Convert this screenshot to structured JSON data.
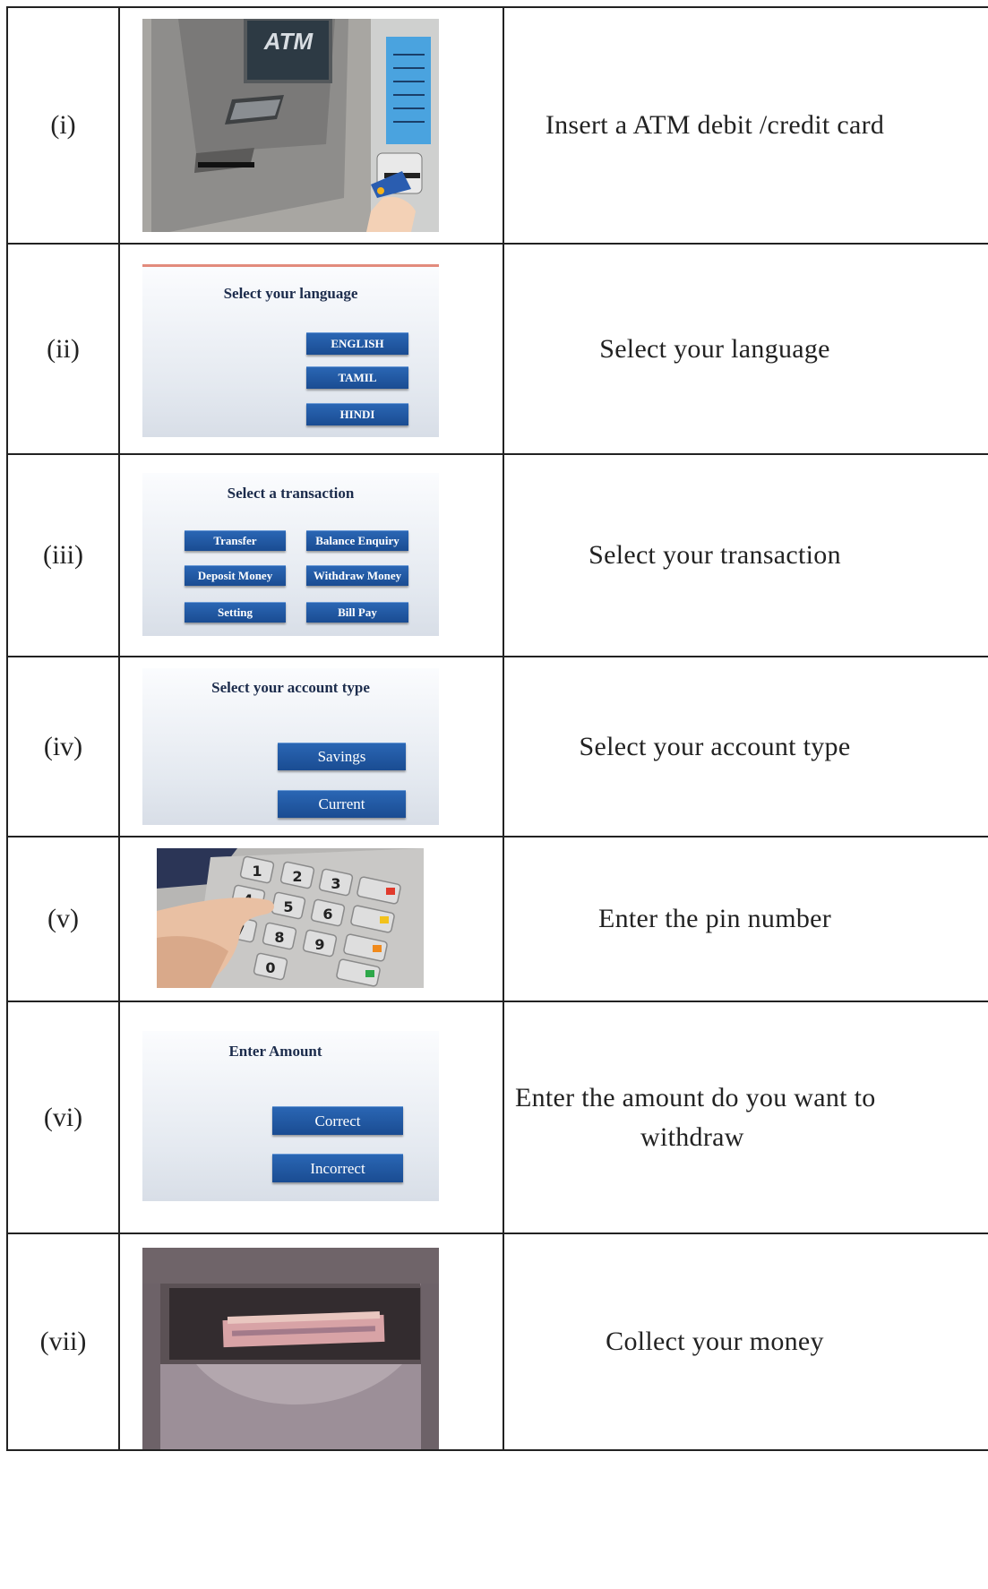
{
  "rows": [
    {
      "num": "(i)",
      "desc": "Insert a ATM debit /credit card",
      "image": {
        "kind": "atm-card-slot-photo",
        "label": "ATM"
      }
    },
    {
      "num": "(ii)",
      "desc": "Select your language",
      "image": {
        "kind": "language-screen",
        "title": "Select your language",
        "buttons": [
          "ENGLISH",
          "TAMIL",
          "HINDI"
        ]
      }
    },
    {
      "num": "(iii)",
      "desc": "Select your transaction",
      "image": {
        "kind": "transaction-screen",
        "title": "Select a transaction",
        "buttons": [
          "Transfer",
          "Balance Enquiry",
          "Deposit Money",
          "Withdraw Money",
          "Setting",
          "Bill Pay"
        ]
      }
    },
    {
      "num": "(iv)",
      "desc": "Select your account type",
      "image": {
        "kind": "account-screen",
        "title": "Select your account type",
        "buttons": [
          "Savings",
          "Current"
        ]
      }
    },
    {
      "num": "(v)",
      "desc": "Enter the pin number",
      "image": {
        "kind": "keypad-photo",
        "keys": [
          "1",
          "2",
          "3",
          "4",
          "5",
          "6",
          "7",
          "8",
          "9",
          "0"
        ]
      }
    },
    {
      "num": "(vi)",
      "desc_line1": "Enter the amount do you want to",
      "desc_line2": "withdraw",
      "image": {
        "kind": "amount-screen",
        "title": "Enter Amount",
        "buttons": [
          "Correct",
          "Incorrect"
        ]
      }
    },
    {
      "num": "(vii)",
      "desc": "Collect your money",
      "image": {
        "kind": "cash-dispenser-photo"
      }
    }
  ]
}
